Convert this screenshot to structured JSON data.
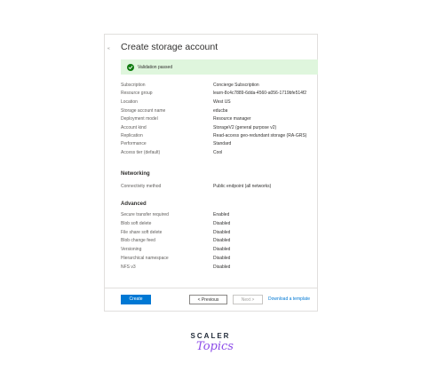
{
  "panel": {
    "collapse_glyph": "«",
    "title": "Create storage account",
    "validation": "Validation passed"
  },
  "summary": [
    {
      "key": "Subscription",
      "value": "Concierge Subscription"
    },
    {
      "key": "Resource group",
      "value": "learn-8c4c7889-6dda-4560-a056-1719bfe514f2"
    },
    {
      "key": "Location",
      "value": "West US"
    },
    {
      "key": "Storage account name",
      "value": "educba"
    },
    {
      "key": "Deployment model",
      "value": "Resource manager"
    },
    {
      "key": "Account kind",
      "value": "StorageV2 (general purpose v2)"
    },
    {
      "key": "Replication",
      "value": "Read-access geo-redundant storage (RA-GRS)"
    },
    {
      "key": "Performance",
      "value": "Standard"
    },
    {
      "key": "Access tier (default)",
      "value": "Cool"
    }
  ],
  "networking": {
    "title": "Networking",
    "rows": [
      {
        "key": "Connectivity method",
        "value": "Public endpoint (all networks)"
      }
    ]
  },
  "advanced": {
    "title": "Advanced",
    "rows": [
      {
        "key": "Secure transfer required",
        "value": "Enabled"
      },
      {
        "key": "Blob soft delete",
        "value": "Disabled"
      },
      {
        "key": "File share soft delete",
        "value": "Disabled"
      },
      {
        "key": "Blob change feed",
        "value": "Disabled"
      },
      {
        "key": "Versioning",
        "value": "Disabled"
      },
      {
        "key": "Hierarchical namespace",
        "value": "Disabled"
      },
      {
        "key": "NFS v3",
        "value": "Disabled"
      }
    ]
  },
  "footer": {
    "create": "Create",
    "previous": "< Previous",
    "next": "Next >",
    "download": "Download a template"
  },
  "brand": {
    "top": "SCALER",
    "bottom": "Topics",
    "accent_color": "#8c4be8"
  },
  "colors": {
    "primary": "#0078d4",
    "success_bg": "#dff6dd",
    "success_icon": "#107c10"
  }
}
